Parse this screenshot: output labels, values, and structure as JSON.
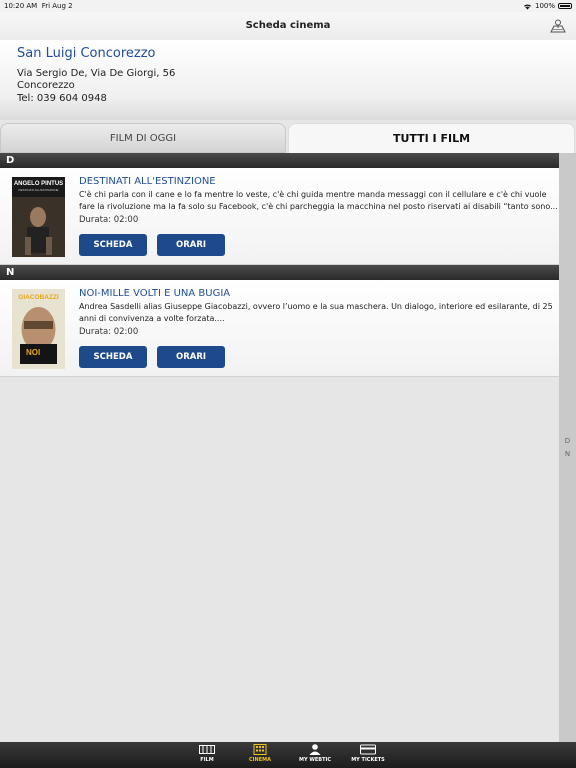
{
  "status_bar": {
    "time": "10:20 AM",
    "date": "Fri Aug 2",
    "battery": "100%"
  },
  "nav": {
    "title": "Scheda cinema",
    "map_icon": "map-icon"
  },
  "cinema": {
    "name": "San Luigi Concorezzo",
    "address": "Via Sergio De, Via De Giorgi, 56",
    "city": "Concorezzo",
    "phone": "Tel: 039 604 0948"
  },
  "tabs": [
    {
      "label": "FILM DI OGGI",
      "active": false
    },
    {
      "label": "TUTTI I FILM",
      "active": true
    }
  ],
  "sections": [
    {
      "letter": "D",
      "movies": [
        {
          "title": "DESTINATI ALL'ESTINZIONE",
          "synopsis": "C'è chi parla con il cane e lo fa mentre lo veste, c'è chi guida mentre manda messaggi con il cellulare e c'è chi vuole fare la rivoluzione ma la fa solo su Facebook, c'è chi parcheggia la macchina nel posto riservati ai disabili “tanto sono...",
          "duration": "Durata: 02:00",
          "poster_top": "ANGELO PINTUS",
          "poster_sub": "DESTINATI ALL'ESTINZIONE",
          "scheda_label": "SCHEDA",
          "orari_label": "ORARI"
        }
      ]
    },
    {
      "letter": "N",
      "movies": [
        {
          "title": "NOI-MILLE VOLTI E UNA BUGIA",
          "synopsis": "Andrea Sasdelli alias Giuseppe Giacobazzi, ovvero l’uomo e la sua maschera. Un dialogo, interiore ed esilarante, di 25 anni di convivenza a volte forzata....",
          "duration": "Durata: 02:00",
          "poster_top": "GIACOBAZZI",
          "poster_sub": "NOI",
          "scheda_label": "SCHEDA",
          "orari_label": "ORARI"
        }
      ]
    }
  ],
  "index": [
    "D",
    "N"
  ],
  "tab_bar": [
    {
      "label": "FILM",
      "icon": "film-icon",
      "active": false
    },
    {
      "label": "CINEMA",
      "icon": "cinema-icon",
      "active": true
    },
    {
      "label": "MY WEBTIC",
      "icon": "user-icon",
      "active": false
    },
    {
      "label": "MY TICKETS",
      "icon": "ticket-icon",
      "active": false
    }
  ],
  "colors": {
    "accent": "#1f4e9a",
    "button": "#1e4a8c",
    "active_tab": "#f0c419"
  }
}
